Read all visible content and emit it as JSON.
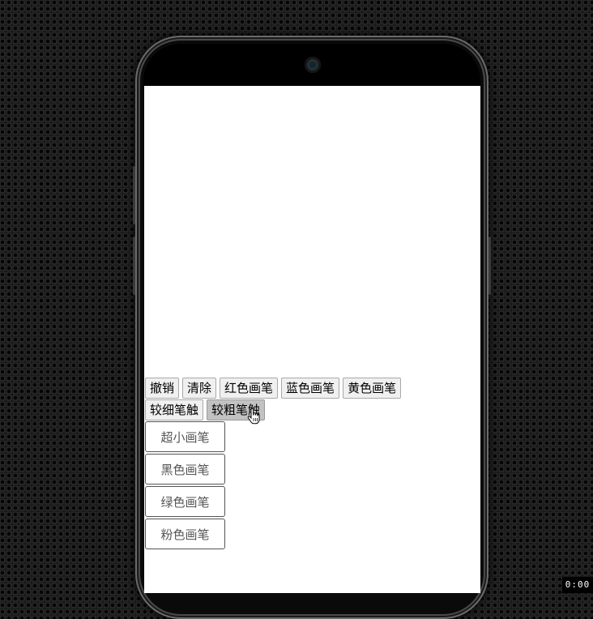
{
  "toolbar": {
    "row1": [
      "撤销",
      "清除",
      "红色画笔",
      "蓝色画笔",
      "黄色画笔"
    ],
    "row2": [
      "较细笔触",
      "较粗笔触"
    ],
    "active_button": "较粗笔触"
  },
  "brushes": [
    "超小画笔",
    "黑色画笔",
    "绿色画笔",
    "粉色画笔"
  ],
  "overlay": {
    "timer": "0:00"
  },
  "icons": {
    "cursor": "hand-pointer-icon",
    "camera": "front-camera-icon"
  }
}
